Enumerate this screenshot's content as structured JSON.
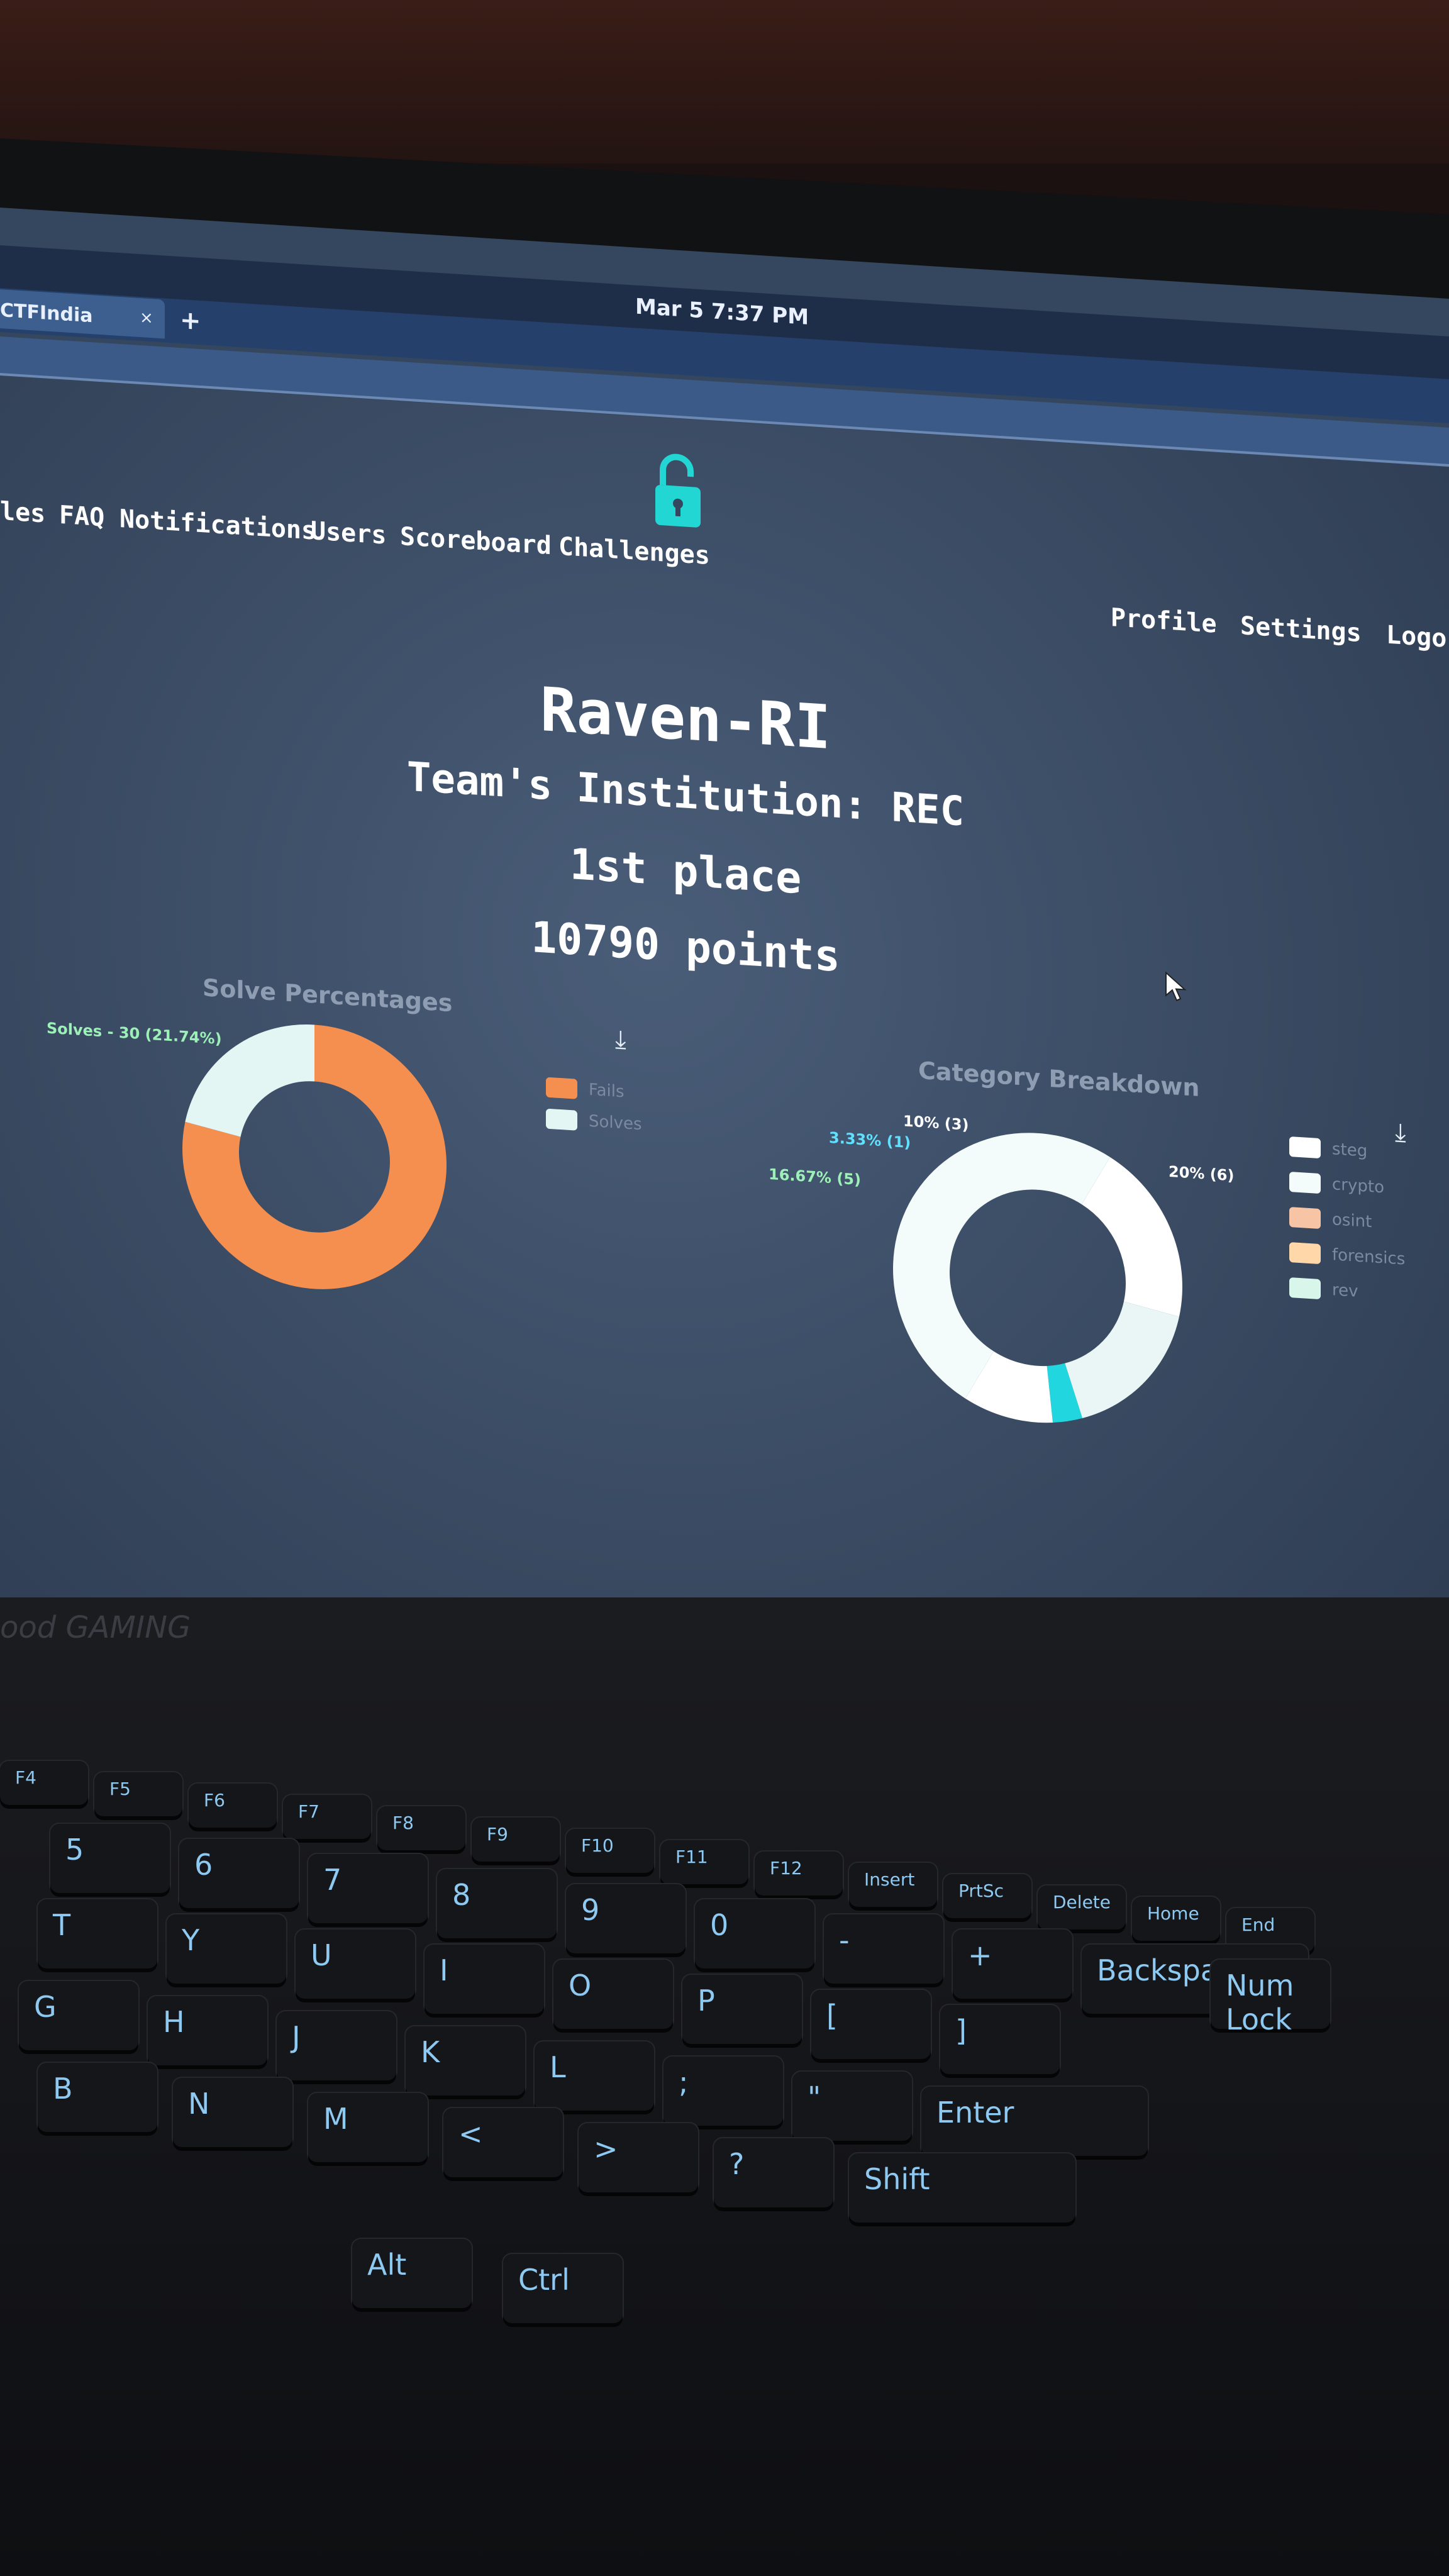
{
  "system": {
    "clock": "Mar 5   7:37 PM"
  },
  "browser": {
    "tab_title": "CTFIndia",
    "tab_close": "×",
    "tab_add": "+"
  },
  "nav": {
    "left": [
      "les",
      "FAQ",
      "Notifications",
      "Users",
      "Scoreboard",
      "Challenges"
    ],
    "right": [
      "Profile",
      "Settings",
      "Logo"
    ]
  },
  "team": {
    "name": "Raven-RI",
    "institution": "Team's Institution: REC",
    "place": "1st place",
    "points": "10790 points"
  },
  "charts": {
    "download_icon": "download-icon",
    "solve_title": "Solve Percentages",
    "category_title": "Category Breakdown"
  },
  "chart_data": [
    {
      "type": "pie",
      "title": "Solve Percentages",
      "categories": [
        "Fails",
        "Solves"
      ],
      "values": [
        78.26,
        21.74
      ],
      "labels": [
        "Solves - 30 (21.74%)"
      ],
      "colors": [
        "#f58f4f",
        "#e3f6f3"
      ],
      "legend": [
        "Fails",
        "Solves"
      ]
    },
    {
      "type": "pie",
      "title": "Category Breakdown",
      "categories": [
        "steg",
        "crypto",
        "osint",
        "forensics",
        "rev"
      ],
      "labels": [
        "10% (3)",
        "3.33% (1)",
        "16.67% (5)",
        "20% (6)"
      ],
      "colors": [
        "#ffffff",
        "#f4fbfb",
        "#f7c5a5",
        "#ffd7a8",
        "#d8f6ea"
      ],
      "legend": [
        "steg",
        "crypto",
        "osint",
        "forensics",
        "rev"
      ]
    }
  ],
  "keyboard": {
    "brand": "ood GAMING",
    "keys": [
      "F4",
      "F5",
      "F6",
      "F7",
      "F8",
      "F9",
      "F10",
      "F11",
      "F12",
      "Insert",
      "PrtSc",
      "Delete",
      "Home",
      "End",
      "5",
      "6",
      "7",
      "8",
      "9",
      "0",
      "-",
      "+",
      "Backspace",
      "Num Lock",
      "T",
      "Y",
      "U",
      "I",
      "O",
      "P",
      "[",
      "]",
      "G",
      "H",
      "J",
      "K",
      "L",
      ";",
      "\"",
      "Enter",
      "B",
      "N",
      "M",
      "<",
      ">",
      "?",
      "Shift",
      "Alt",
      "Ctrl"
    ]
  }
}
